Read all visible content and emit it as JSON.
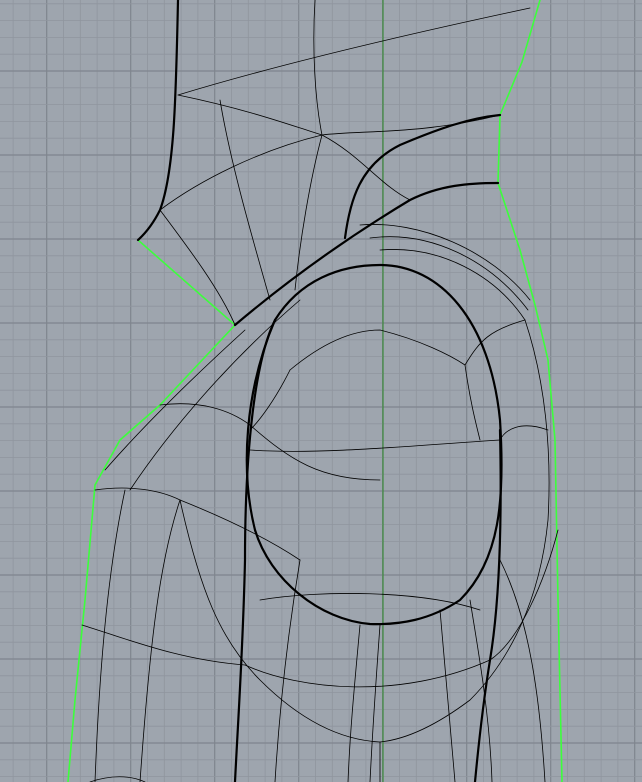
{
  "viewport": {
    "colors": {
      "background": "#9ea5ae",
      "grid_minor": "#8f959e",
      "grid_major": "#7f858e",
      "axis_green": "#3c8a3c",
      "silhouette": "#3cff3c",
      "curve": "#000000"
    }
  }
}
